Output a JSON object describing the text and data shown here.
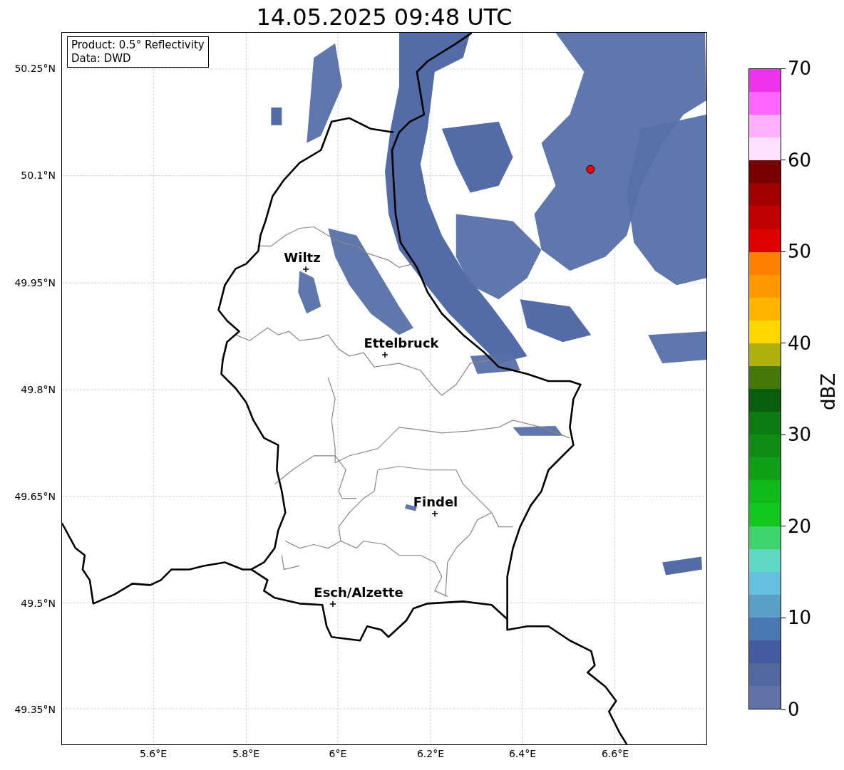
{
  "title": "14.05.2025 09:48 UTC",
  "legend": [
    "Product: 0.5° Reflectivity",
    "Data: DWD"
  ],
  "lat_ticks": [
    "50.25°N",
    "50.1°N",
    "49.95°N",
    "49.8°N",
    "49.65°N",
    "49.5°N",
    "49.35°N"
  ],
  "lon_ticks": [
    "5.6°E",
    "5.8°E",
    "6°E",
    "6.2°E",
    "6.4°E",
    "6.6°E"
  ],
  "cities": [
    {
      "name": "Wiltz"
    },
    {
      "name": "Ettelbruck"
    },
    {
      "name": "Findel"
    },
    {
      "name": "Esch/Alzette"
    }
  ],
  "colorbar": {
    "label": "dBZ",
    "ticks": [
      "70",
      "60",
      "50",
      "40",
      "30",
      "20",
      "10",
      "0"
    ],
    "bands": [
      {
        "color": "#ee33ee"
      },
      {
        "color": "#ff66ff"
      },
      {
        "color": "#ffb0ff"
      },
      {
        "color": "#ffe0ff"
      },
      {
        "color": "#7a0000"
      },
      {
        "color": "#a00000"
      },
      {
        "color": "#c00000"
      },
      {
        "color": "#e00000"
      },
      {
        "color": "#ff7f00"
      },
      {
        "color": "#ff9800"
      },
      {
        "color": "#ffb400"
      },
      {
        "color": "#ffd700"
      },
      {
        "color": "#b0b00a"
      },
      {
        "color": "#467808"
      },
      {
        "color": "#085e0a"
      },
      {
        "color": "#0c7c12"
      },
      {
        "color": "#0e8c14"
      },
      {
        "color": "#10a018"
      },
      {
        "color": "#10b81a"
      },
      {
        "color": "#12c81e"
      },
      {
        "color": "#3dd46c"
      },
      {
        "color": "#5fd8c4"
      },
      {
        "color": "#64c0de"
      },
      {
        "color": "#5a9fc8"
      },
      {
        "color": "#4a78b0"
      },
      {
        "color": "#435ca0"
      },
      {
        "color": "#53679f"
      },
      {
        "color": "#6271a6"
      }
    ]
  }
}
